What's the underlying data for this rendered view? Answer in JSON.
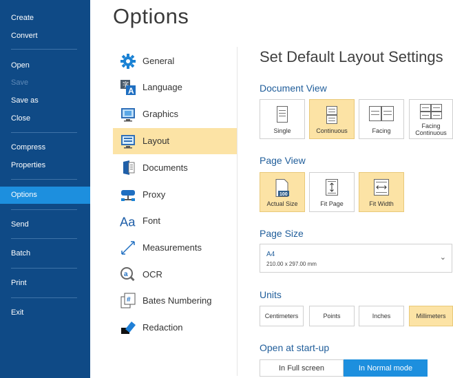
{
  "sidebar": {
    "items": [
      {
        "label": "Create"
      },
      {
        "label": "Convert"
      },
      {
        "label": "Open"
      },
      {
        "label": "Save"
      },
      {
        "label": "Save as"
      },
      {
        "label": "Close"
      },
      {
        "label": "Compress"
      },
      {
        "label": "Properties"
      },
      {
        "label": "Options"
      },
      {
        "label": "Send"
      },
      {
        "label": "Batch"
      },
      {
        "label": "Print"
      },
      {
        "label": "Exit"
      }
    ]
  },
  "page_title": "Options",
  "categories": [
    {
      "label": "General",
      "icon": "gear-icon"
    },
    {
      "label": "Language",
      "icon": "language-icon"
    },
    {
      "label": "Graphics",
      "icon": "monitor-icon"
    },
    {
      "label": "Layout",
      "icon": "layout-icon"
    },
    {
      "label": "Documents",
      "icon": "documents-icon"
    },
    {
      "label": "Proxy",
      "icon": "network-icon"
    },
    {
      "label": "Font",
      "icon": "font-icon"
    },
    {
      "label": "Measurements",
      "icon": "ruler-icon"
    },
    {
      "label": "OCR",
      "icon": "ocr-icon"
    },
    {
      "label": "Bates Numbering",
      "icon": "bates-icon"
    },
    {
      "label": "Redaction",
      "icon": "eraser-icon"
    }
  ],
  "panel": {
    "title": "Set Default Layout Settings",
    "document_view": {
      "heading": "Document View",
      "options": [
        "Single",
        "Continuous",
        "Facing",
        "Facing Continuous"
      ],
      "selected": "Continuous"
    },
    "page_view": {
      "heading": "Page View",
      "options": [
        "Actual Size",
        "Fit Page",
        "Fit Width"
      ],
      "selected": [
        "Actual Size",
        "Fit Width"
      ],
      "actual_size_badge": "100"
    },
    "page_size": {
      "heading": "Page Size",
      "value": "A4",
      "dimensions": "210.00 x 297.00 mm",
      "chevron": "⌄"
    },
    "units": {
      "heading": "Units",
      "options": [
        "Centimeters",
        "Points",
        "Inches",
        "Millimeters"
      ],
      "selected": "Millimeters"
    },
    "startup": {
      "heading": "Open at start-up",
      "options": [
        "In Full screen",
        "In Normal mode"
      ],
      "selected": "In Normal mode"
    }
  },
  "colors": {
    "sidebar_bg": "#0f4a86",
    "active_blue": "#1d8fde",
    "selection_yellow": "#fce3a5",
    "heading_blue": "#1f5d9a"
  }
}
